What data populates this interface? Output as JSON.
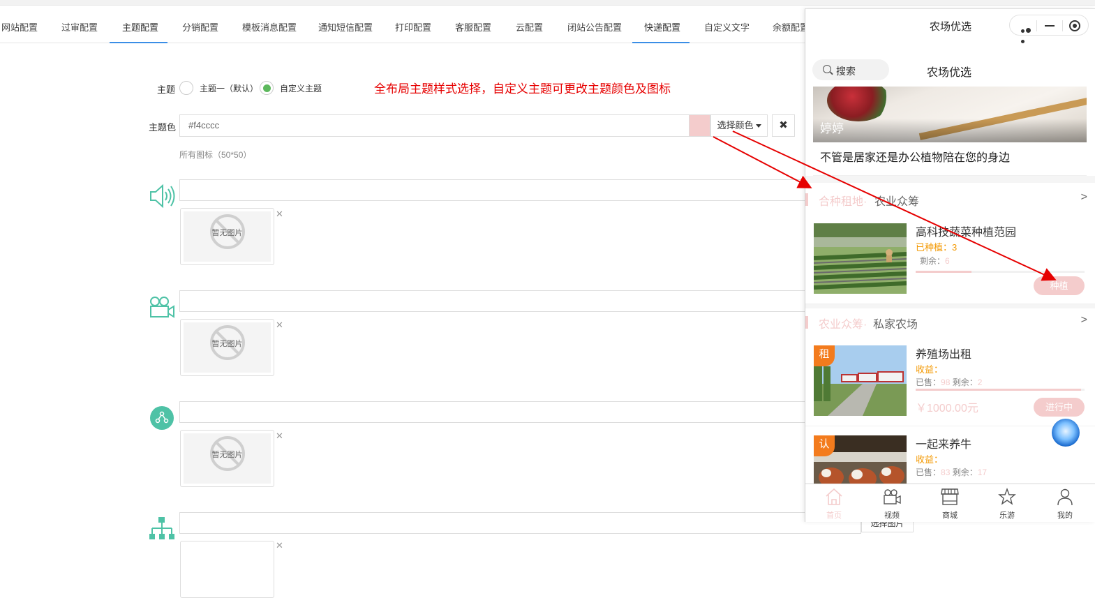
{
  "tabs": [
    {
      "label": "网站配置"
    },
    {
      "label": "过审配置"
    },
    {
      "label": "主题配置",
      "active": true
    },
    {
      "label": "分销配置"
    },
    {
      "label": "模板消息配置"
    },
    {
      "label": "通知短信配置"
    },
    {
      "label": "打印配置"
    },
    {
      "label": "客服配置"
    },
    {
      "label": "云配置"
    },
    {
      "label": "闭站公告配置"
    },
    {
      "label": "快递配置",
      "active": true
    },
    {
      "label": "自定义文字"
    },
    {
      "label": "余额配置"
    }
  ],
  "theme": {
    "label": "主题",
    "option1": "主题一（默认）",
    "option2": "自定义主题",
    "selected": "自定义主题",
    "note": "全布局主题样式选择，自定义主题可更改主题颜色及图标"
  },
  "color": {
    "label": "主题色",
    "value": "#f4cccc",
    "placeholder": "#f4cccc",
    "pick_label": "选择颜色",
    "clear_label": "✖",
    "swatch_color": "#f4cccc"
  },
  "icons": {
    "hint": "所有图标（50*50）",
    "no_image_text": "暂无图片",
    "remove_label": "✕",
    "select_label": "选择图片",
    "accent_color": "#4ec2a6",
    "items": [
      {
        "icon": "speaker-icon"
      },
      {
        "icon": "video-camera-icon"
      },
      {
        "icon": "share-icon"
      },
      {
        "icon": "org-chart-icon"
      }
    ]
  },
  "phone": {
    "title": "农场优选",
    "search_label": "搜索",
    "brand": "农场优选",
    "banner_caption": "婷婷",
    "tagline": "不管是居家还是办公植物陪在您的身边",
    "section1": {
      "title_colored": "合种租地·",
      "title_plain": "农业众筹",
      "more": ">"
    },
    "item1": {
      "name": "高科技蔬菜种植范园",
      "planted_label": "已种植：",
      "planted": "3",
      "remain_label": "剩余：",
      "remain": "6",
      "progress": 0.33,
      "action": "种植"
    },
    "section2": {
      "title_colored": "农业众筹·",
      "title_plain": "私家农场",
      "more": ">"
    },
    "item2": {
      "badge": "租",
      "name": "养殖场出租",
      "income_label": "收益：",
      "sold_label": "已售：",
      "sold": "98",
      "remain_label": "剩余：",
      "remain": "2",
      "progress": 0.98,
      "price": "￥1000.00元",
      "action": "进行中"
    },
    "item3": {
      "badge": "认",
      "name": "一起来养牛",
      "income_label": "收益：",
      "sold_label": "已售：",
      "sold": "83",
      "remain_label": "剩余：",
      "remain": "17"
    },
    "tabbar": [
      {
        "label": "首页",
        "icon": "home-icon",
        "active": true
      },
      {
        "label": "视频",
        "icon": "video-camera-icon"
      },
      {
        "label": "商城",
        "icon": "store-icon"
      },
      {
        "label": "乐游",
        "icon": "star-icon"
      },
      {
        "label": "我的",
        "icon": "user-icon"
      }
    ],
    "theme_color": "#f4cccc",
    "orange": "#f39800"
  },
  "annotation_color": "#e60000"
}
